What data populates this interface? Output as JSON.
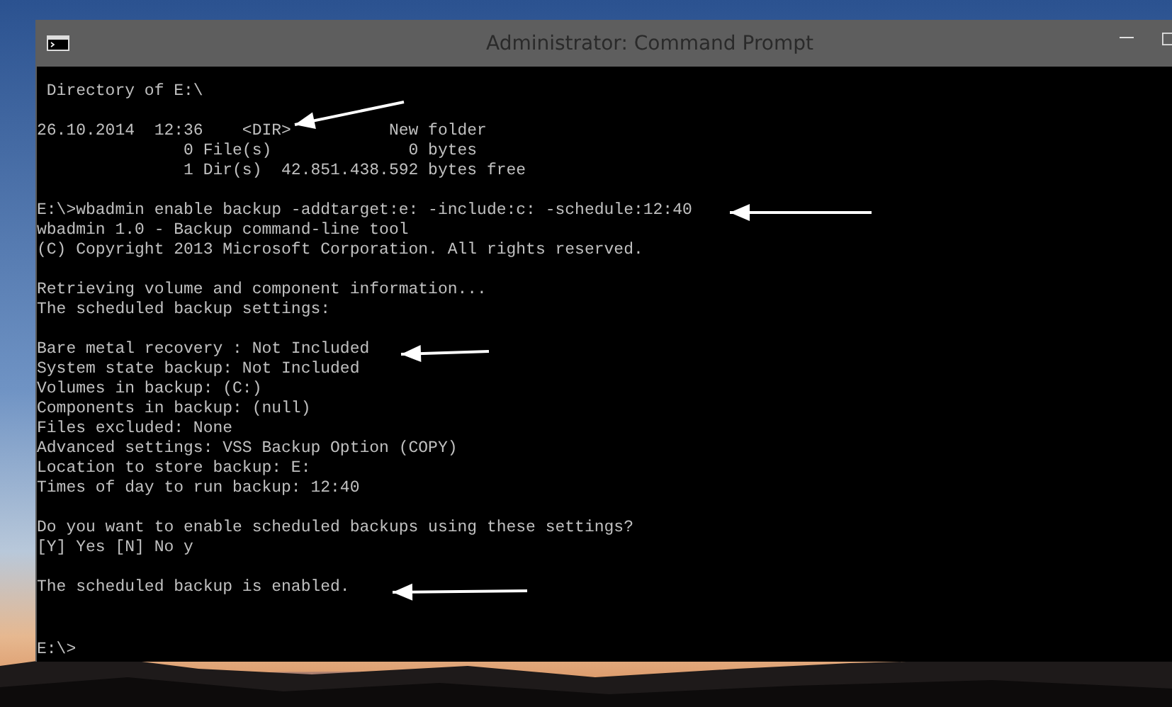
{
  "window": {
    "title": "Administrator: Command Prompt"
  },
  "console": {
    "blocks": [
      [
        " Directory of E:\\"
      ],
      [
        "26.10.2014  12:36    <DIR>          New folder",
        "               0 File(s)              0 bytes",
        "               1 Dir(s)  42.851.438.592 bytes free"
      ],
      [
        "E:\\>wbadmin enable backup -addtarget:e: -include:c: -schedule:12:40",
        "wbadmin 1.0 - Backup command-line tool",
        "(C) Copyright 2013 Microsoft Corporation. All rights reserved."
      ],
      [
        "Retrieving volume and component information...",
        "The scheduled backup settings:"
      ],
      [
        "Bare metal recovery : Not Included",
        "System state backup: Not Included",
        "Volumes in backup: (C:)",
        "Components in backup: (null)",
        "Files excluded: None",
        "Advanced settings: VSS Backup Option (COPY)",
        "Location to store backup: E:",
        "Times of day to run backup: 12:40"
      ],
      [
        "Do you want to enable scheduled backups using these settings?",
        "[Y] Yes [N] No y"
      ],
      [
        "The scheduled backup is enabled."
      ]
    ],
    "prompt": "E:\\>"
  }
}
